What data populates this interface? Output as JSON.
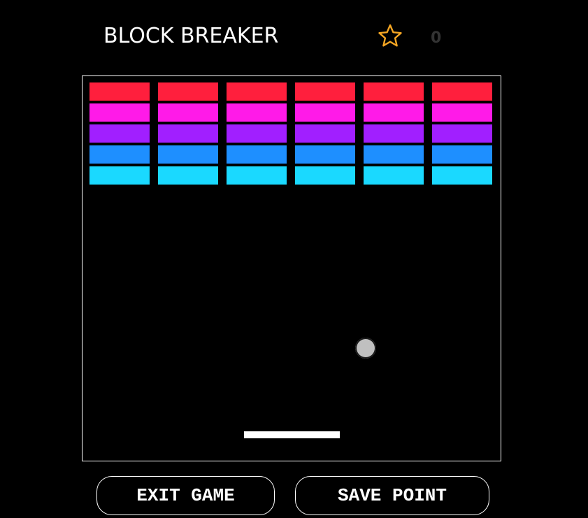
{
  "header": {
    "title": "BLOCK BREAKER",
    "star_icon": "star-outline-icon",
    "star_color": "#f5a623",
    "score": "0"
  },
  "game": {
    "brick_rows": [
      {
        "color": "#ff1f3d",
        "count": 6
      },
      {
        "color": "#ff1ae8",
        "count": 6
      },
      {
        "color": "#a11fff",
        "count": 6
      },
      {
        "color": "#1e8fff",
        "count": 6
      },
      {
        "color": "#1ad9ff",
        "count": 6
      }
    ],
    "ball_color": "#c0c0c0",
    "paddle_color": "#ffffff",
    "border_color": "#ffffff"
  },
  "buttons": {
    "exit_label": "EXIT GAME",
    "save_label": "SAVE POINT"
  }
}
